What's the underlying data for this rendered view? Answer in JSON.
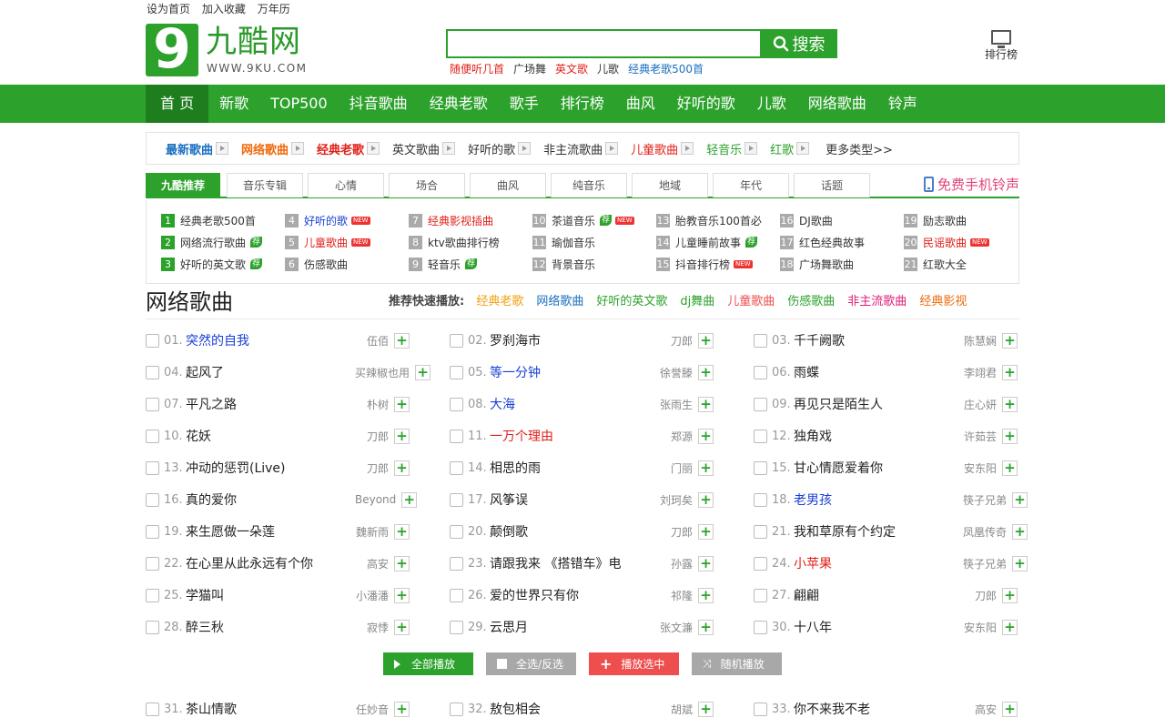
{
  "top_links": [
    "设为首页",
    "加入收藏",
    "万年历"
  ],
  "logo": {
    "glyph": "9",
    "name": "九酷网",
    "url": "WWW.9KU.COM"
  },
  "search": {
    "value": "",
    "placeholder": "",
    "button": "搜索"
  },
  "hot_searches": [
    {
      "text": "随便听几首",
      "color": "#e0201a"
    },
    {
      "text": "广场舞",
      "color": "#333333"
    },
    {
      "text": "英文歌",
      "color": "#e0201a"
    },
    {
      "text": "儿歌",
      "color": "#333333"
    },
    {
      "text": "经典老歌500首",
      "color": "#1a6fc1"
    }
  ],
  "rank_link": "排行榜",
  "nav": [
    "首 页",
    "新歌",
    "TOP500",
    "抖音歌曲",
    "经典老歌",
    "歌手",
    "排行榜",
    "曲风",
    "好听的歌",
    "儿歌",
    "网络歌曲",
    "铃声"
  ],
  "categories": [
    {
      "text": "最新歌曲",
      "color": "#1a6fc1",
      "bold": true
    },
    {
      "text": "网络歌曲",
      "color": "#f06a0c",
      "bold": true
    },
    {
      "text": "经典老歌",
      "color": "#e0201a",
      "bold": true
    },
    {
      "text": "英文歌曲",
      "color": "#333333",
      "bold": false
    },
    {
      "text": "好听的歌",
      "color": "#333333",
      "bold": false
    },
    {
      "text": "非主流歌曲",
      "color": "#333333",
      "bold": false
    },
    {
      "text": "儿童歌曲",
      "color": "#e0201a",
      "bold": false
    },
    {
      "text": "轻音乐",
      "color": "#2ca22c",
      "bold": false
    },
    {
      "text": "红歌",
      "color": "#2ca22c",
      "bold": false
    }
  ],
  "more_types": "更多类型>>",
  "tabs": [
    "九酷推荐",
    "音乐专辑",
    "心情",
    "场合",
    "曲风",
    "纯音乐",
    "地域",
    "年代",
    "话题"
  ],
  "ringtone": "免费手机铃声",
  "topics": [
    {
      "n": "1",
      "text": "经典老歌500首",
      "color": "#333333",
      "badge": ""
    },
    {
      "n": "2",
      "text": "网络流行歌曲",
      "color": "#333333",
      "badge": "荐"
    },
    {
      "n": "3",
      "text": "好听的英文歌",
      "color": "#333333",
      "badge": "荐"
    },
    {
      "n": "4",
      "text": "好听的歌",
      "color": "#1a3fd6",
      "badge": "NEW"
    },
    {
      "n": "5",
      "text": "儿童歌曲",
      "color": "#e0201a",
      "badge": "NEW"
    },
    {
      "n": "6",
      "text": "伤感歌曲",
      "color": "#333333",
      "badge": ""
    },
    {
      "n": "7",
      "text": "经典影视插曲",
      "color": "#e0201a",
      "badge": ""
    },
    {
      "n": "8",
      "text": "ktv歌曲排行榜",
      "color": "#333333",
      "badge": ""
    },
    {
      "n": "9",
      "text": "轻音乐",
      "color": "#333333",
      "badge": "荐"
    },
    {
      "n": "10",
      "text": "茶道音乐",
      "color": "#333333",
      "badge": "荐NEW"
    },
    {
      "n": "11",
      "text": "瑜伽音乐",
      "color": "#333333",
      "badge": ""
    },
    {
      "n": "12",
      "text": "背景音乐",
      "color": "#333333",
      "badge": ""
    },
    {
      "n": "13",
      "text": "胎教音乐100首必",
      "color": "#333333",
      "badge": ""
    },
    {
      "n": "14",
      "text": "儿童睡前故事",
      "color": "#333333",
      "badge": "荐"
    },
    {
      "n": "15",
      "text": "抖音排行榜",
      "color": "#333333",
      "badge": "NEW"
    },
    {
      "n": "16",
      "text": "DJ歌曲",
      "color": "#333333",
      "badge": ""
    },
    {
      "n": "17",
      "text": "红色经典故事",
      "color": "#333333",
      "badge": ""
    },
    {
      "n": "18",
      "text": "广场舞歌曲",
      "color": "#333333",
      "badge": ""
    },
    {
      "n": "19",
      "text": "励志歌曲",
      "color": "#333333",
      "badge": ""
    },
    {
      "n": "20",
      "text": "民谣歌曲",
      "color": "#e0201a",
      "badge": "NEW"
    },
    {
      "n": "21",
      "text": "红歌大全",
      "color": "#333333",
      "badge": ""
    }
  ],
  "section_title": "网络歌曲",
  "quickplay": {
    "label": "推荐快速播放:",
    "items": [
      {
        "text": "经典老歌",
        "color": "#f0a010"
      },
      {
        "text": "网络歌曲",
        "color": "#1a6fc1"
      },
      {
        "text": "好听的英文歌",
        "color": "#2ca22c"
      },
      {
        "text": "dj舞曲",
        "color": "#2ca22c"
      },
      {
        "text": "儿童歌曲",
        "color": "#ef4e4e"
      },
      {
        "text": "伤感歌曲",
        "color": "#2ca22c"
      },
      {
        "text": "非主流歌曲",
        "color": "#e0207a"
      },
      {
        "text": "经典影视",
        "color": "#f06a0c"
      }
    ]
  },
  "songs": [
    {
      "no": "01.",
      "title": "突然的自我",
      "artist": "伍佰",
      "color": "blue"
    },
    {
      "no": "02.",
      "title": "罗刹海市",
      "artist": "刀郎",
      "color": ""
    },
    {
      "no": "03.",
      "title": "千千阙歌",
      "artist": "陈慧娴",
      "color": ""
    },
    {
      "no": "04.",
      "title": "起风了",
      "artist": "买辣椒也用",
      "color": ""
    },
    {
      "no": "05.",
      "title": "等一分钟",
      "artist": "徐誉滕",
      "color": "blue"
    },
    {
      "no": "06.",
      "title": "雨蝶",
      "artist": "李翊君",
      "color": ""
    },
    {
      "no": "07.",
      "title": "平凡之路",
      "artist": "朴树",
      "color": ""
    },
    {
      "no": "08.",
      "title": "大海",
      "artist": "张雨生",
      "color": "blue"
    },
    {
      "no": "09.",
      "title": "再见只是陌生人",
      "artist": "庄心妍",
      "color": ""
    },
    {
      "no": "10.",
      "title": "花妖",
      "artist": "刀郎",
      "color": ""
    },
    {
      "no": "11.",
      "title": "一万个理由",
      "artist": "郑源",
      "color": "red"
    },
    {
      "no": "12.",
      "title": "独角戏",
      "artist": "许茹芸",
      "color": ""
    },
    {
      "no": "13.",
      "title": "冲动的惩罚(Live)",
      "artist": "刀郎",
      "color": ""
    },
    {
      "no": "14.",
      "title": "相思的雨",
      "artist": "门丽",
      "color": ""
    },
    {
      "no": "15.",
      "title": "甘心情愿爱着你",
      "artist": "安东阳",
      "color": ""
    },
    {
      "no": "16.",
      "title": "真的爱你",
      "artist": "Beyond",
      "color": ""
    },
    {
      "no": "17.",
      "title": "风筝误",
      "artist": "刘珂矣",
      "color": ""
    },
    {
      "no": "18.",
      "title": "老男孩",
      "artist": "筷子兄弟",
      "color": "blue"
    },
    {
      "no": "19.",
      "title": "来生愿做一朵莲",
      "artist": "魏新雨",
      "color": ""
    },
    {
      "no": "20.",
      "title": "颠倒歌",
      "artist": "刀郎",
      "color": ""
    },
    {
      "no": "21.",
      "title": "我和草原有个约定",
      "artist": "凤凰传奇",
      "color": ""
    },
    {
      "no": "22.",
      "title": "在心里从此永远有个你",
      "artist": "高安",
      "color": ""
    },
    {
      "no": "23.",
      "title": "请跟我来 《搭错车》电",
      "artist": "孙露",
      "color": ""
    },
    {
      "no": "24.",
      "title": "小苹果",
      "artist": "筷子兄弟",
      "color": "red"
    },
    {
      "no": "25.",
      "title": "学猫叫",
      "artist": "小潘潘",
      "color": ""
    },
    {
      "no": "26.",
      "title": "爱的世界只有你",
      "artist": "祁隆",
      "color": ""
    },
    {
      "no": "27.",
      "title": "翩翩",
      "artist": "刀郎",
      "color": ""
    },
    {
      "no": "28.",
      "title": "醉三秋",
      "artist": "寂悸",
      "color": ""
    },
    {
      "no": "29.",
      "title": "云思月",
      "artist": "张文濂",
      "color": ""
    },
    {
      "no": "30.",
      "title": "十八年",
      "artist": "安东阳",
      "color": ""
    },
    {
      "no": "31.",
      "title": "茶山情歌",
      "artist": "任妙音",
      "color": ""
    },
    {
      "no": "32.",
      "title": "敖包相会",
      "artist": "胡斌",
      "color": ""
    },
    {
      "no": "33.",
      "title": "你不来我不老",
      "artist": "高安",
      "color": ""
    }
  ],
  "actions": {
    "play_all": "全部播放",
    "select_all": "全选/反选",
    "play_selected": "播放选中",
    "random_play": "随机播放"
  },
  "add_symbol": "+"
}
